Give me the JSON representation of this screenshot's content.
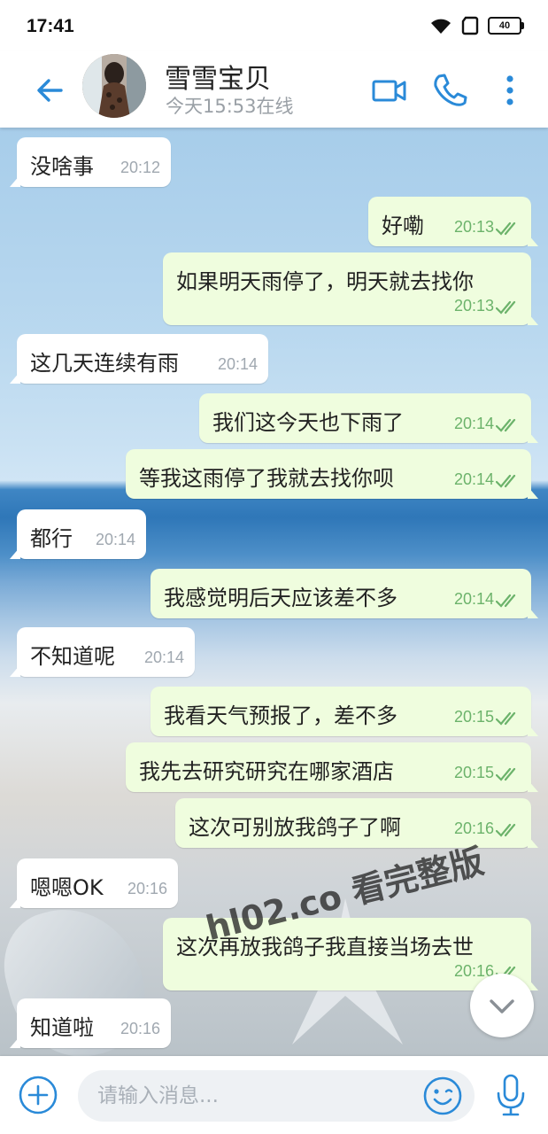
{
  "status_bar": {
    "time": "17:41",
    "battery": "40"
  },
  "header": {
    "contact_name": "雪雪宝贝",
    "contact_status": "今天15:53在线",
    "icons": [
      "back-arrow-icon",
      "video-call-icon",
      "phone-icon",
      "more-vert-icon"
    ]
  },
  "messages": [
    {
      "dir": "in",
      "text": "没啥事",
      "time": "20:12"
    },
    {
      "dir": "out",
      "text": "好嘞",
      "time": "20:13",
      "read": true
    },
    {
      "dir": "out",
      "text": "如果明天雨停了，明天就去找你",
      "time": "20:13",
      "read": true
    },
    {
      "dir": "in",
      "text": "这几天连续有雨",
      "time": "20:14"
    },
    {
      "dir": "out",
      "text": "我们这今天也下雨了",
      "time": "20:14",
      "read": true
    },
    {
      "dir": "out",
      "text": "等我这雨停了我就去找你呗",
      "time": "20:14",
      "read": true
    },
    {
      "dir": "in",
      "text": "都行",
      "time": "20:14"
    },
    {
      "dir": "out",
      "text": "我感觉明后天应该差不多",
      "time": "20:14",
      "read": true
    },
    {
      "dir": "in",
      "text": "不知道呢",
      "time": "20:14"
    },
    {
      "dir": "out",
      "text": "我看天气预报了，差不多",
      "time": "20:15",
      "read": true
    },
    {
      "dir": "out",
      "text": "我先去研究研究在哪家酒店",
      "time": "20:15",
      "read": true
    },
    {
      "dir": "out",
      "text": "这次可别放我鸽子了啊",
      "time": "20:16",
      "read": true
    },
    {
      "dir": "in",
      "text": "嗯嗯OK",
      "time": "20:16"
    },
    {
      "dir": "out",
      "text": "这次再放我鸽子我直接当场去世",
      "time": "20:16",
      "read": true
    },
    {
      "dir": "in",
      "text": "知道啦",
      "time": "20:16"
    }
  ],
  "watermark": "hl02.co 看完整版",
  "composer": {
    "placeholder": "请输入消息..."
  },
  "colors": {
    "accent": "#2a8ad8",
    "outgoing_bubble": "#effdde",
    "incoming_bubble": "#ffffff",
    "read_check": "#6cb36b"
  }
}
